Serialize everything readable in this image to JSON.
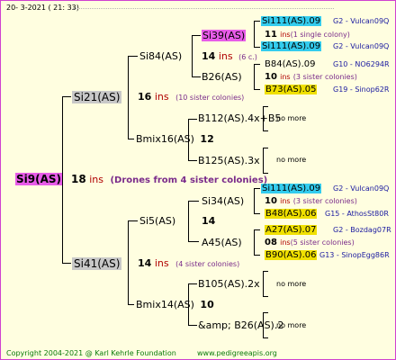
{
  "header_date": "20-  3-2021 ( 21: 33)",
  "root": {
    "name": "Si9(AS)",
    "num": "18",
    "ins": "ins",
    "note": "(Drones from 4 sister colonies)"
  },
  "f1": {
    "name": "Si21(AS)"
  },
  "f2": {
    "name": "Si41(AS)"
  },
  "n_si84": {
    "name": "Si84(AS)",
    "num": "16",
    "ins": "ins",
    "note": "(10 sister colonies)"
  },
  "n_bmix16": {
    "name": "Bmix16(AS)",
    "num": "12"
  },
  "n_si5": {
    "name": "Si5(AS)",
    "num": "14",
    "ins": "ins",
    "note": "(4 sister colonies)"
  },
  "n_bmix14": {
    "name": "Bmix14(AS)",
    "num": "10"
  },
  "n_si39": {
    "name": "Si39(AS)",
    "num": "14",
    "ins": "ins",
    "note": "(6 c.)"
  },
  "n_b26": {
    "name": "B26(AS)"
  },
  "n_b112": {
    "name": "B112(AS).4x+B5"
  },
  "n_b125": {
    "name": "B125(AS).3x"
  },
  "n_si34": {
    "name": "Si34(AS)"
  },
  "n_a45": {
    "name": "A45(AS)"
  },
  "n_b105": {
    "name": "B105(AS).2x"
  },
  "n_b26amp": {
    "name": "&amp; B26(AS).2"
  },
  "no_more": "no more",
  "r_si111_a": {
    "name": "Si111(AS).09",
    "info": "G2 - Vulcan09Q"
  },
  "r_11_a": {
    "num": "11",
    "ins": "ins",
    "note": "(1 single colony)"
  },
  "r_si111_b": {
    "name": "Si111(AS).09",
    "info": "G2 - Vulcan09Q"
  },
  "r_b84": {
    "name": "B84(AS).09",
    "info": "G10 - NO6294R"
  },
  "r_10_a": {
    "num": "10",
    "ins": "ins",
    "note": "(3 sister colonies)"
  },
  "r_b73": {
    "name": "B73(AS).05",
    "info": "G19 - Sinop62R"
  },
  "r_si111_c": {
    "name": "Si111(AS).09",
    "info": "G2 - Vulcan09Q"
  },
  "r_10_b": {
    "num": "10",
    "ins": "ins",
    "note": "(3 sister colonies)"
  },
  "r_b48": {
    "name": "B48(AS).06",
    "info": "G15 - AthosSt80R"
  },
  "r_a27": {
    "name": "A27(AS).07",
    "info": "G2 - Bozdag07R"
  },
  "r_08": {
    "num": "08",
    "ins": "ins",
    "note": "(5 sister colonies)"
  },
  "r_b90": {
    "name": "B90(AS).06",
    "info": "G13 - SinopEgg86R"
  },
  "footer_copyright": "Copyright 2004-2021 @ Karl Kehrle Foundation",
  "footer_url": "www.pedigreeapis.org",
  "colors": {
    "border": "#d040d0",
    "background": "#fffee0",
    "pink": "#e85ce8",
    "cyan": "#33ccee",
    "yellow": "#f0e000",
    "gray": "#c8c8c8",
    "ins_red": "#b00000"
  }
}
